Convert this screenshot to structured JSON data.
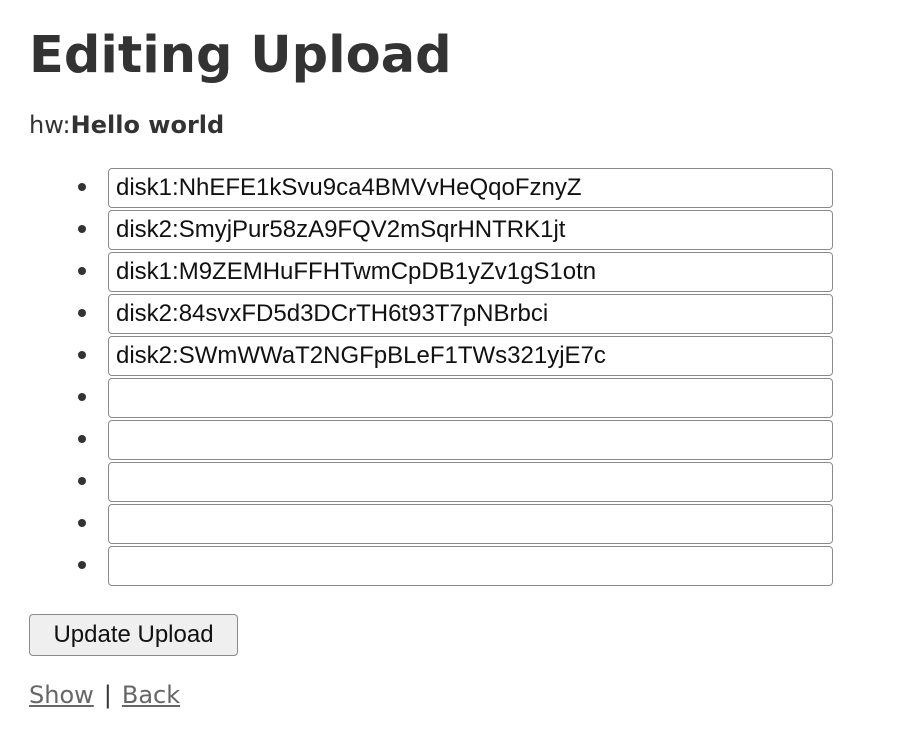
{
  "page": {
    "title": "Editing Upload",
    "meta_label": "hw:",
    "meta_value": "Hello world"
  },
  "form": {
    "disks": [
      {
        "value": "disk1:NhEFE1kSvu9ca4BMVvHeQqoFznyZ"
      },
      {
        "value": "disk2:SmyjPur58zA9FQV2mSqrHNTRK1jt"
      },
      {
        "value": "disk1:M9ZEMHuFFHTwmCpDB1yZv1gS1otn"
      },
      {
        "value": "disk2:84svxFD5d3DCrTH6t93T7pNBrbci"
      },
      {
        "value": "disk2:SWmWWaT2NGFpBLeF1TWs321yjE7c"
      },
      {
        "value": ""
      },
      {
        "value": ""
      },
      {
        "value": ""
      },
      {
        "value": ""
      },
      {
        "value": ""
      }
    ],
    "submit_label": "Update Upload"
  },
  "links": {
    "show_label": "Show",
    "separator": "|",
    "back_label": "Back"
  },
  "colors": {
    "text": "#333333",
    "link": "#666666",
    "button_bg": "#efefef",
    "border": "#8a8a8a"
  }
}
